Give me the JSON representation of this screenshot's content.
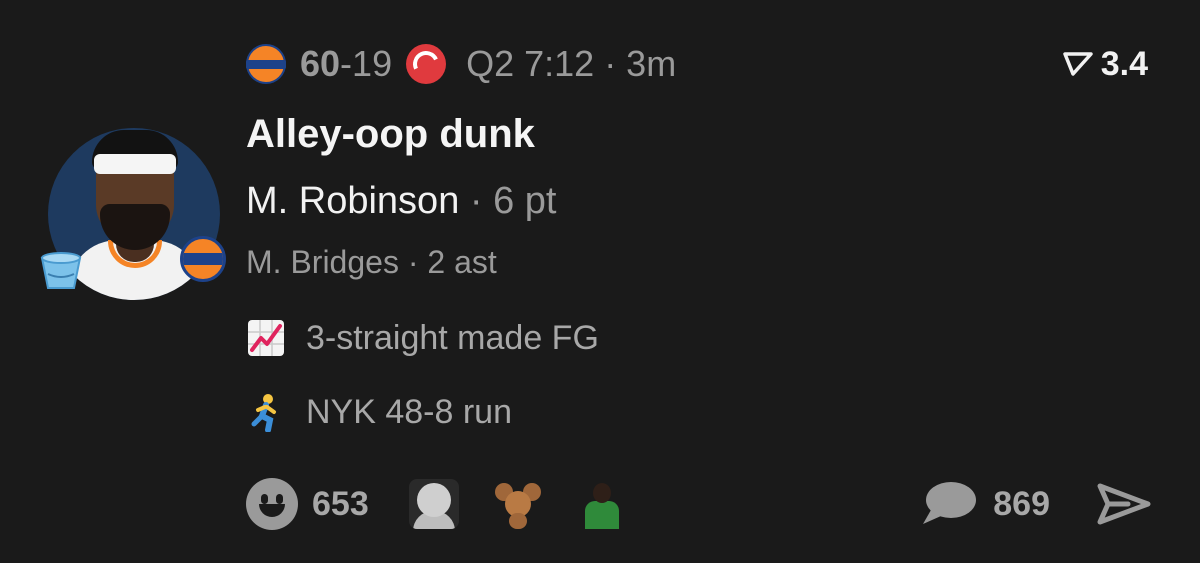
{
  "header": {
    "home_team_icon": "knicks-logo-icon",
    "home_score": "60",
    "score_separator": "-",
    "away_score": "19",
    "away_team_icon": "hawks-logo-icon",
    "game_clock": "Q2 7:12 · 3m",
    "meter_icon": "trend-arrow-icon",
    "meter_value": "3.4"
  },
  "play": {
    "title": "Alley-oop dunk",
    "scorer_name": "M. Robinson",
    "scorer_stat": " · 6 pt",
    "assist": "M. Bridges · 2 ast",
    "avatar_badges": [
      "bucket-icon",
      "knicks-logo-icon"
    ]
  },
  "notes": [
    {
      "icon": "chart-increasing-icon",
      "text": "3-straight made FG"
    },
    {
      "icon": "runner-icon",
      "text": "NYK 48-8 run"
    }
  ],
  "footer": {
    "reaction_icon": "smiley-icon",
    "reaction_count": "653",
    "reactor_avatars": [
      "baby-reactor",
      "jerry-reactor",
      "keeper-reactor"
    ],
    "comment_icon": "comment-bubble-icon",
    "comment_count": "869",
    "share_icon": "share-arrow-icon"
  },
  "colors": {
    "background": "#1a1a1a",
    "text_primary": "#f2f2f2",
    "text_muted": "#9a9a9a",
    "knicks_orange": "#f58426",
    "knicks_blue": "#1d428a",
    "hawks_red": "#e03a3e"
  }
}
